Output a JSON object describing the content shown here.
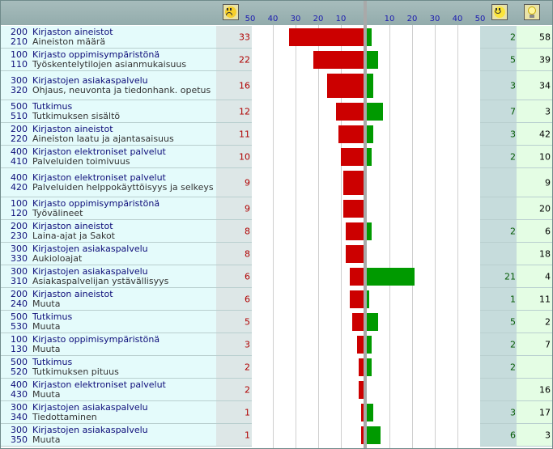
{
  "chart_data": {
    "type": "bar",
    "axis_ticks": [
      "50",
      "40",
      "30",
      "20",
      "10",
      "10",
      "20",
      "30",
      "40",
      "50"
    ],
    "xlim_negative": [
      0,
      50
    ],
    "xlim_positive": [
      0,
      50
    ],
    "header_icons": {
      "negative": "sad-face-icon",
      "positive": "happy-face-icon",
      "ideas": "lightbulb-icon"
    },
    "colors": {
      "negative": "#cc0000",
      "positive": "#009a00"
    },
    "rows": [
      {
        "code1": "200",
        "code2": "210",
        "title": "Kirjaston aineistot",
        "subtitle": "Aineiston määrä",
        "negative": "33",
        "positive": "2",
        "ideas": "58"
      },
      {
        "code1": "100",
        "code2": "110",
        "title": "Kirjasto oppimisympäristönä",
        "subtitle": "Työskentelytilojen asianmukaisuus",
        "negative": "22",
        "positive": "5",
        "ideas": "39"
      },
      {
        "code1": "300",
        "code2": "320",
        "title": "Kirjastojen asiakaspalvelu",
        "subtitle": "Ohjaus, neuvonta ja tiedonhank. opetus",
        "negative": "16",
        "positive": "3",
        "ideas": "34"
      },
      {
        "code1": "500",
        "code2": "510",
        "title": "Tutkimus",
        "subtitle": "Tutkimuksen sisältö",
        "negative": "12",
        "positive": "7",
        "ideas": "3"
      },
      {
        "code1": "200",
        "code2": "220",
        "title": "Kirjaston aineistot",
        "subtitle": "Aineiston laatu ja ajantasaisuus",
        "negative": "11",
        "positive": "3",
        "ideas": "42"
      },
      {
        "code1": "400",
        "code2": "410",
        "title": "Kirjaston elektroniset palvelut",
        "subtitle": "Palveluiden toimivuus",
        "negative": "10",
        "positive": "2",
        "ideas": "10"
      },
      {
        "code1": "400",
        "code2": "420",
        "title": "Kirjaston elektroniset palvelut",
        "subtitle": "Palveluiden helppokäyttöisyys ja selkeys",
        "negative": "9",
        "positive": "",
        "ideas": "9"
      },
      {
        "code1": "100",
        "code2": "120",
        "title": "Kirjasto oppimisympäristönä",
        "subtitle": "Työvälineet",
        "negative": "9",
        "positive": "",
        "ideas": "20"
      },
      {
        "code1": "200",
        "code2": "230",
        "title": "Kirjaston aineistot",
        "subtitle": "Laina-ajat ja Sakot",
        "negative": "8",
        "positive": "2",
        "ideas": "6"
      },
      {
        "code1": "300",
        "code2": "330",
        "title": "Kirjastojen asiakaspalvelu",
        "subtitle": "Aukioloajat",
        "negative": "8",
        "positive": "",
        "ideas": "18"
      },
      {
        "code1": "300",
        "code2": "310",
        "title": "Kirjastojen asiakaspalvelu",
        "subtitle": "Asiakaspalvelijan ystävällisyys",
        "negative": "6",
        "positive": "21",
        "ideas": "4"
      },
      {
        "code1": "200",
        "code2": "240",
        "title": "Kirjaston aineistot",
        "subtitle": "Muuta",
        "negative": "6",
        "positive": "1",
        "ideas": "11"
      },
      {
        "code1": "500",
        "code2": "530",
        "title": "Tutkimus",
        "subtitle": "Muuta",
        "negative": "5",
        "positive": "5",
        "ideas": "2"
      },
      {
        "code1": "100",
        "code2": "130",
        "title": "Kirjasto oppimisympäristönä",
        "subtitle": "Muuta",
        "negative": "3",
        "positive": "2",
        "ideas": "7"
      },
      {
        "code1": "500",
        "code2": "520",
        "title": "Tutkimus",
        "subtitle": "Tutkimuksen pituus",
        "negative": "2",
        "positive": "2",
        "ideas": ""
      },
      {
        "code1": "400",
        "code2": "430",
        "title": "Kirjaston elektroniset palvelut",
        "subtitle": "Muuta",
        "negative": "2",
        "positive": "",
        "ideas": "16"
      },
      {
        "code1": "300",
        "code2": "340",
        "title": "Kirjastojen asiakaspalvelu",
        "subtitle": "Tiedottaminen",
        "negative": "1",
        "positive": "3",
        "ideas": "17"
      },
      {
        "code1": "300",
        "code2": "350",
        "title": "Kirjastojen asiakaspalvelu",
        "subtitle": "Muuta",
        "negative": "1",
        "positive": "6",
        "ideas": "3"
      }
    ]
  }
}
